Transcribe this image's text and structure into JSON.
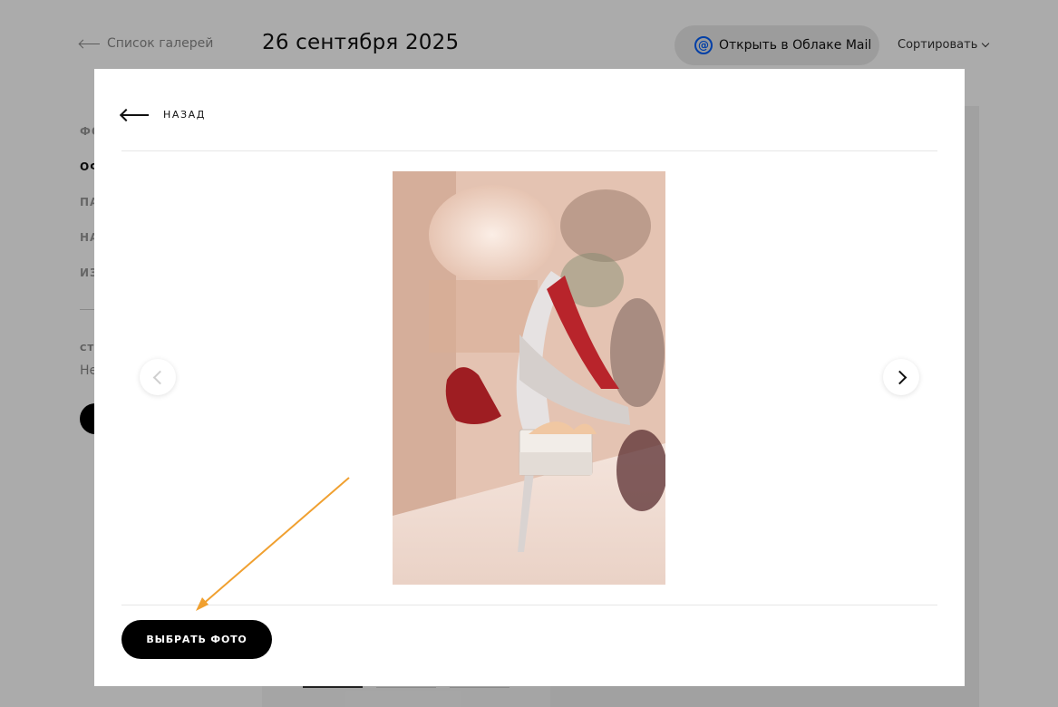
{
  "header": {
    "back_label": "Список галерей",
    "title": "26 сентября 2025",
    "cloud_button_label": "Открыть в Облаке Mail",
    "sort_label": "Сортировать"
  },
  "sidebar": {
    "items": [
      "ФО",
      "ОФ",
      "ПА",
      "НА",
      "ИЗ"
    ],
    "status_label": "СТА",
    "status_value": "Не"
  },
  "modal": {
    "back_label": "НАЗАД",
    "select_button_label": "ВЫБРАТЬ ФОТО"
  },
  "colors": {
    "accent": "#005ff9",
    "annotation_arrow": "#f0a030",
    "button_bg": "#000000"
  },
  "icons": {
    "back": "arrow-left-icon",
    "prev": "chevron-left-icon",
    "next": "chevron-right-icon",
    "cloud": "at-sign-icon",
    "sort": "chevron-down-icon"
  }
}
